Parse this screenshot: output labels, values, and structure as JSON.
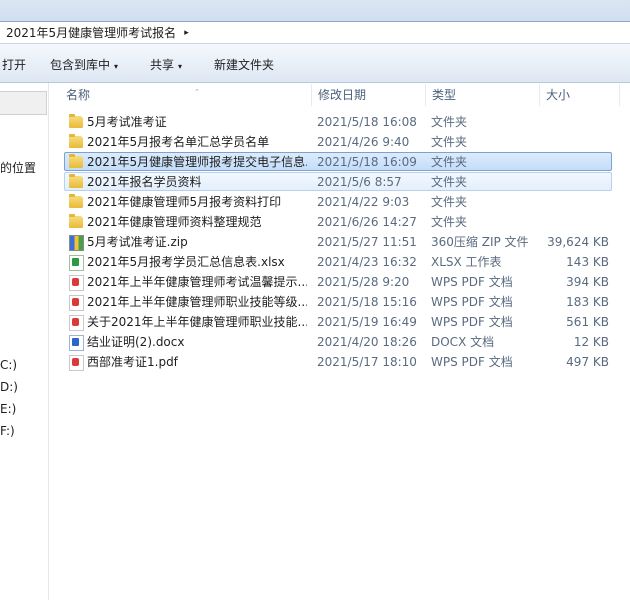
{
  "address": {
    "path": "2021年5月健康管理师考试报名",
    "arrow": "▸"
  },
  "toolbar": {
    "open": "打开",
    "include_library": "包含到库中",
    "share": "共享",
    "new_folder": "新建文件夹",
    "dropdown_glyph": "▾"
  },
  "nav": {
    "items": [
      "的位置",
      "C:)",
      "D:)",
      "E:)",
      "F:)"
    ]
  },
  "columns": {
    "name": "名称",
    "date": "修改日期",
    "type": "类型",
    "size": "大小",
    "sort_glyph": "⌃"
  },
  "files": [
    {
      "name": "5月考试准考证",
      "date": "2021/5/18 16:08",
      "type": "文件夹",
      "size": "",
      "icon": "folder-icon",
      "state": ""
    },
    {
      "name": "2021年5月报考名单汇总学员名单",
      "date": "2021/4/26 9:40",
      "type": "文件夹",
      "size": "",
      "icon": "folder-icon",
      "state": ""
    },
    {
      "name": "2021年5月健康管理师报考提交电子信息...",
      "date": "2021/5/18 16:09",
      "type": "文件夹",
      "size": "",
      "icon": "folder-icon",
      "state": "selected"
    },
    {
      "name": "2021年报名学员资料",
      "date": "2021/5/6 8:57",
      "type": "文件夹",
      "size": "",
      "icon": "folder-icon",
      "state": "hover"
    },
    {
      "name": "2021年健康管理师5月报考资料打印",
      "date": "2021/4/22 9:03",
      "type": "文件夹",
      "size": "",
      "icon": "folder-icon",
      "state": ""
    },
    {
      "name": "2021年健康管理师资料整理规范",
      "date": "2021/6/26 14:27",
      "type": "文件夹",
      "size": "",
      "icon": "folder-icon",
      "state": ""
    },
    {
      "name": "5月考试准考证.zip",
      "date": "2021/5/27 11:51",
      "type": "360压缩 ZIP 文件",
      "size": "39,624 KB",
      "icon": "zip-icon",
      "state": ""
    },
    {
      "name": "2021年5月报考学员汇总信息表.xlsx",
      "date": "2021/4/23 16:32",
      "type": "XLSX 工作表",
      "size": "143 KB",
      "icon": "xlsx-icon",
      "state": ""
    },
    {
      "name": "2021年上半年健康管理师考试温馨提示....",
      "date": "2021/5/28 9:20",
      "type": "WPS PDF 文档",
      "size": "394 KB",
      "icon": "pdf-icon",
      "state": ""
    },
    {
      "name": "2021年上半年健康管理师职业技能等级...",
      "date": "2021/5/18 15:16",
      "type": "WPS PDF 文档",
      "size": "183 KB",
      "icon": "pdf-icon",
      "state": ""
    },
    {
      "name": "关于2021年上半年健康管理师职业技能...",
      "date": "2021/5/19 16:49",
      "type": "WPS PDF 文档",
      "size": "561 KB",
      "icon": "pdf-icon",
      "state": ""
    },
    {
      "name": "结业证明(2).docx",
      "date": "2021/4/20 18:26",
      "type": "DOCX 文档",
      "size": "12 KB",
      "icon": "docx-icon",
      "state": ""
    },
    {
      "name": "西部准考证1.pdf",
      "date": "2021/5/17 18:10",
      "type": "WPS PDF 文档",
      "size": "497 KB",
      "icon": "pdf-icon",
      "state": ""
    }
  ]
}
